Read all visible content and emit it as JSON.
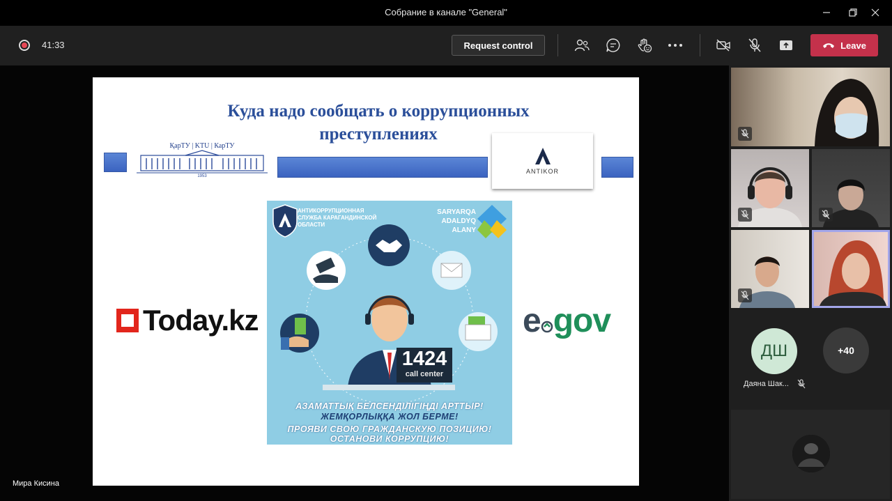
{
  "window": {
    "title": "Собрание в канале \"General\""
  },
  "toolbar": {
    "timer": "41:33",
    "request_control_label": "Request control",
    "leave_label": "Leave",
    "colors": {
      "leave": "#c4314b",
      "record": "#e74856"
    }
  },
  "slide": {
    "title": "Куда надо сообщать о коррупционных преступлениях",
    "ktu_logo_text": "ҚарТУ | KTU | КарТУ",
    "ktu_year": "1953",
    "antikor_label": "ANTIKOR",
    "today_logo": "Today.kz",
    "egov_logo": {
      "e": "e",
      "gov": "gov"
    },
    "poster": {
      "org_name": "Антикоррупционная служба Карагандинской области",
      "brand": [
        "SARYARQA",
        "ADALDYQ",
        "ALANY"
      ],
      "hotline_number": "1424",
      "hotline_caption": "call center",
      "slogan_kz_1": "АЗАМАТТЫҚ БЕЛСЕНДІЛІГІҢДІ АРТТЫР!",
      "slogan_kz_2": "ЖЕМҚОРЛЫҚҚА ЖОЛ БЕРМЕ!",
      "slogan_ru_1": "ПРОЯВИ СВОЮ ГРАЖДАНСКУЮ ПОЗИЦИЮ!",
      "slogan_ru_2": "ОСТАНОВИ КОРРУПЦИЮ!"
    }
  },
  "presenter": {
    "name": "Мира Кисина"
  },
  "participants": {
    "avatar_initials": "ДШ",
    "avatar_name": "Даяна Шак...",
    "overflow_count": "+40"
  }
}
